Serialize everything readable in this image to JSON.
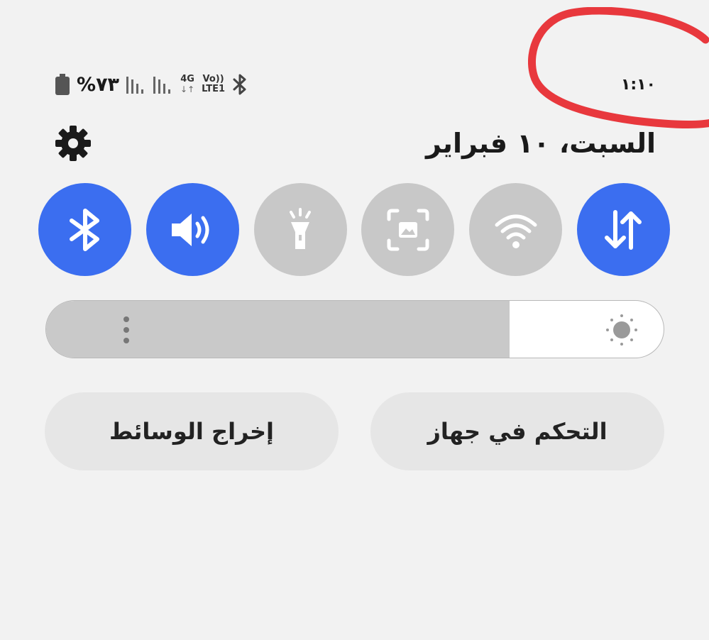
{
  "status_bar": {
    "clock": "١:١٠",
    "battery_text": "%٧٣",
    "network_top": "4G",
    "volte_top": "Vo))",
    "volte_bottom": "LTE1",
    "icons": [
      "battery-icon",
      "signal-icon",
      "signal-icon",
      "4g-data-icon",
      "volte-icon",
      "bluetooth-icon"
    ]
  },
  "header": {
    "date": "السبت، ١٠ فبراير",
    "settings_icon": "gear-icon"
  },
  "quick_toggles": [
    {
      "id": "mobile-data",
      "icon": "data-arrows-icon",
      "active": true
    },
    {
      "id": "wifi",
      "icon": "wifi-icon",
      "active": false
    },
    {
      "id": "screenshot",
      "icon": "screen-capture-icon",
      "active": false
    },
    {
      "id": "flashlight",
      "icon": "flashlight-icon",
      "active": false
    },
    {
      "id": "sound",
      "icon": "speaker-icon",
      "active": true
    },
    {
      "id": "bluetooth",
      "icon": "bluetooth-icon",
      "active": true
    }
  ],
  "brightness": {
    "level": 0.25,
    "icon": "sun-icon"
  },
  "actions": {
    "device_control": "التحكم في جهاز",
    "media_output": "إخراج الوسائط"
  },
  "colors": {
    "accent": "#3b6ef0",
    "inactive": "#c8c8c8",
    "annotation": "#e8383d"
  }
}
